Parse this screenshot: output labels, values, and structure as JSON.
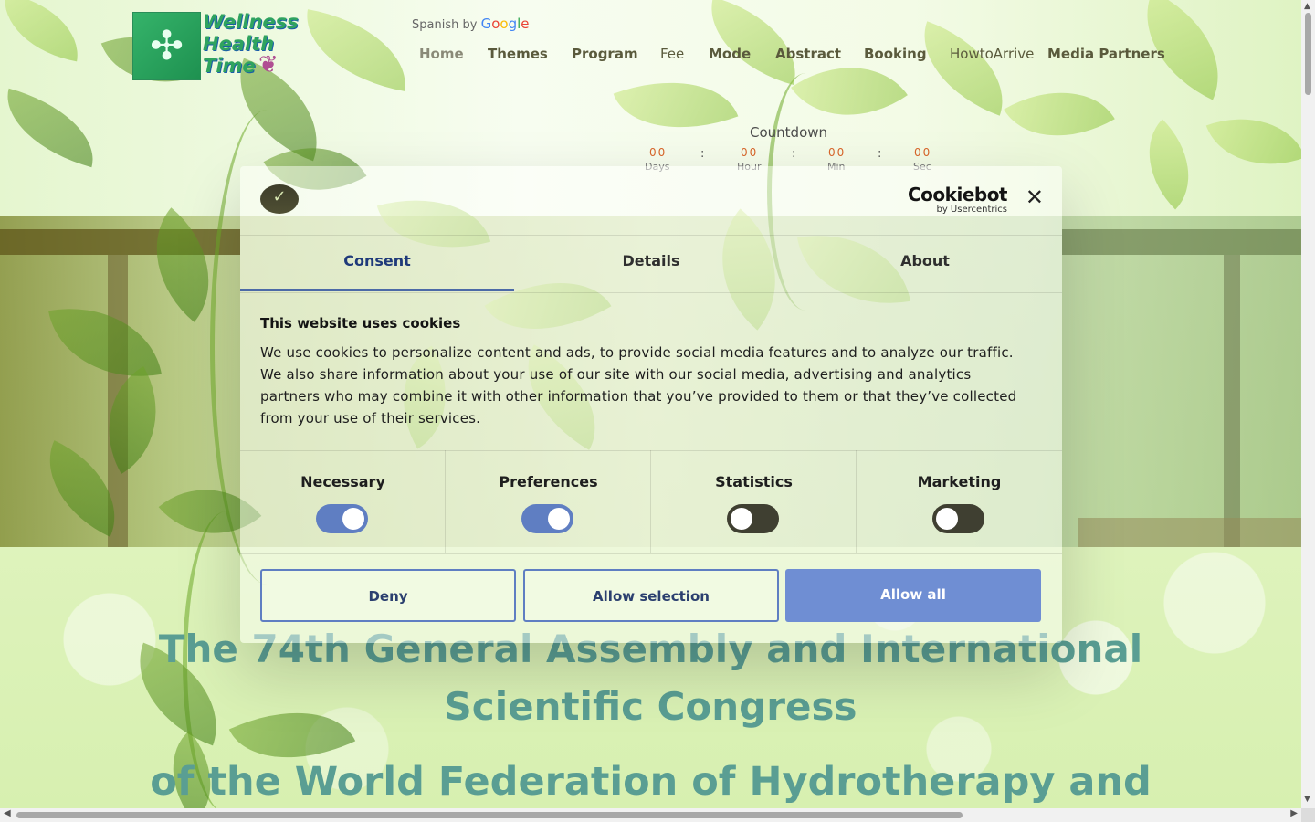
{
  "header": {
    "logo": {
      "line1": "Wellness",
      "line2": "Health",
      "line3": "Time",
      "icon": "arrows-in-icon"
    },
    "translate": {
      "language": "Spanish",
      "by": "by",
      "provider": "Google"
    },
    "nav": [
      {
        "label": "Home"
      },
      {
        "label": "Themes"
      },
      {
        "label": "Program"
      },
      {
        "label": "Fee"
      },
      {
        "label": "Mode"
      },
      {
        "label": "Abstract"
      },
      {
        "label": "Booking"
      },
      {
        "label": "HowtoArrive"
      },
      {
        "label": "Media Partners"
      }
    ],
    "countdown": {
      "title": "Countdown",
      "days": "00",
      "days_label": "Days",
      "hours": "00",
      "hours_label": "Hour",
      "minutes": "00",
      "minutes_label": "Min",
      "seconds": "00",
      "seconds_label": "Sec",
      "separator": ":"
    }
  },
  "main": {
    "title_line1": "The 74th General Assembly and International",
    "title_line2": "Scientific Congress",
    "title_line3": "of the World Federation of Hydrotherapy and"
  },
  "cookie_dialog": {
    "brand": "Cookiebot",
    "brand_by": "by Usercentrics",
    "close_symbol": "✕",
    "tabs": [
      {
        "label": "Consent"
      },
      {
        "label": "Details"
      },
      {
        "label": "About"
      }
    ],
    "active_tab": "Consent",
    "heading": "This website uses cookies",
    "body": "We use cookies to personalize content and ads, to provide social media features and to analyze our traffic. We also share information about your use of our site with our social media, advertising and analytics partners who may combine it with other information that you’ve provided to them or that they’ve collected from your use of their services.",
    "categories": [
      {
        "label": "Necessary",
        "enabled": true
      },
      {
        "label": "Preferences",
        "enabled": true
      },
      {
        "label": "Statistics",
        "enabled": false
      },
      {
        "label": "Marketing",
        "enabled": false
      }
    ],
    "buttons": {
      "deny": "Deny",
      "allow_selection": "Allow selection",
      "allow_all": "Allow all"
    }
  },
  "colors": {
    "accent": "#6f8ed3",
    "toggle_on": "#5f7ec2",
    "toggle_off": "#3f3f31",
    "title_teal": "#5a9e93",
    "countdown_orange": "#d9662a"
  }
}
